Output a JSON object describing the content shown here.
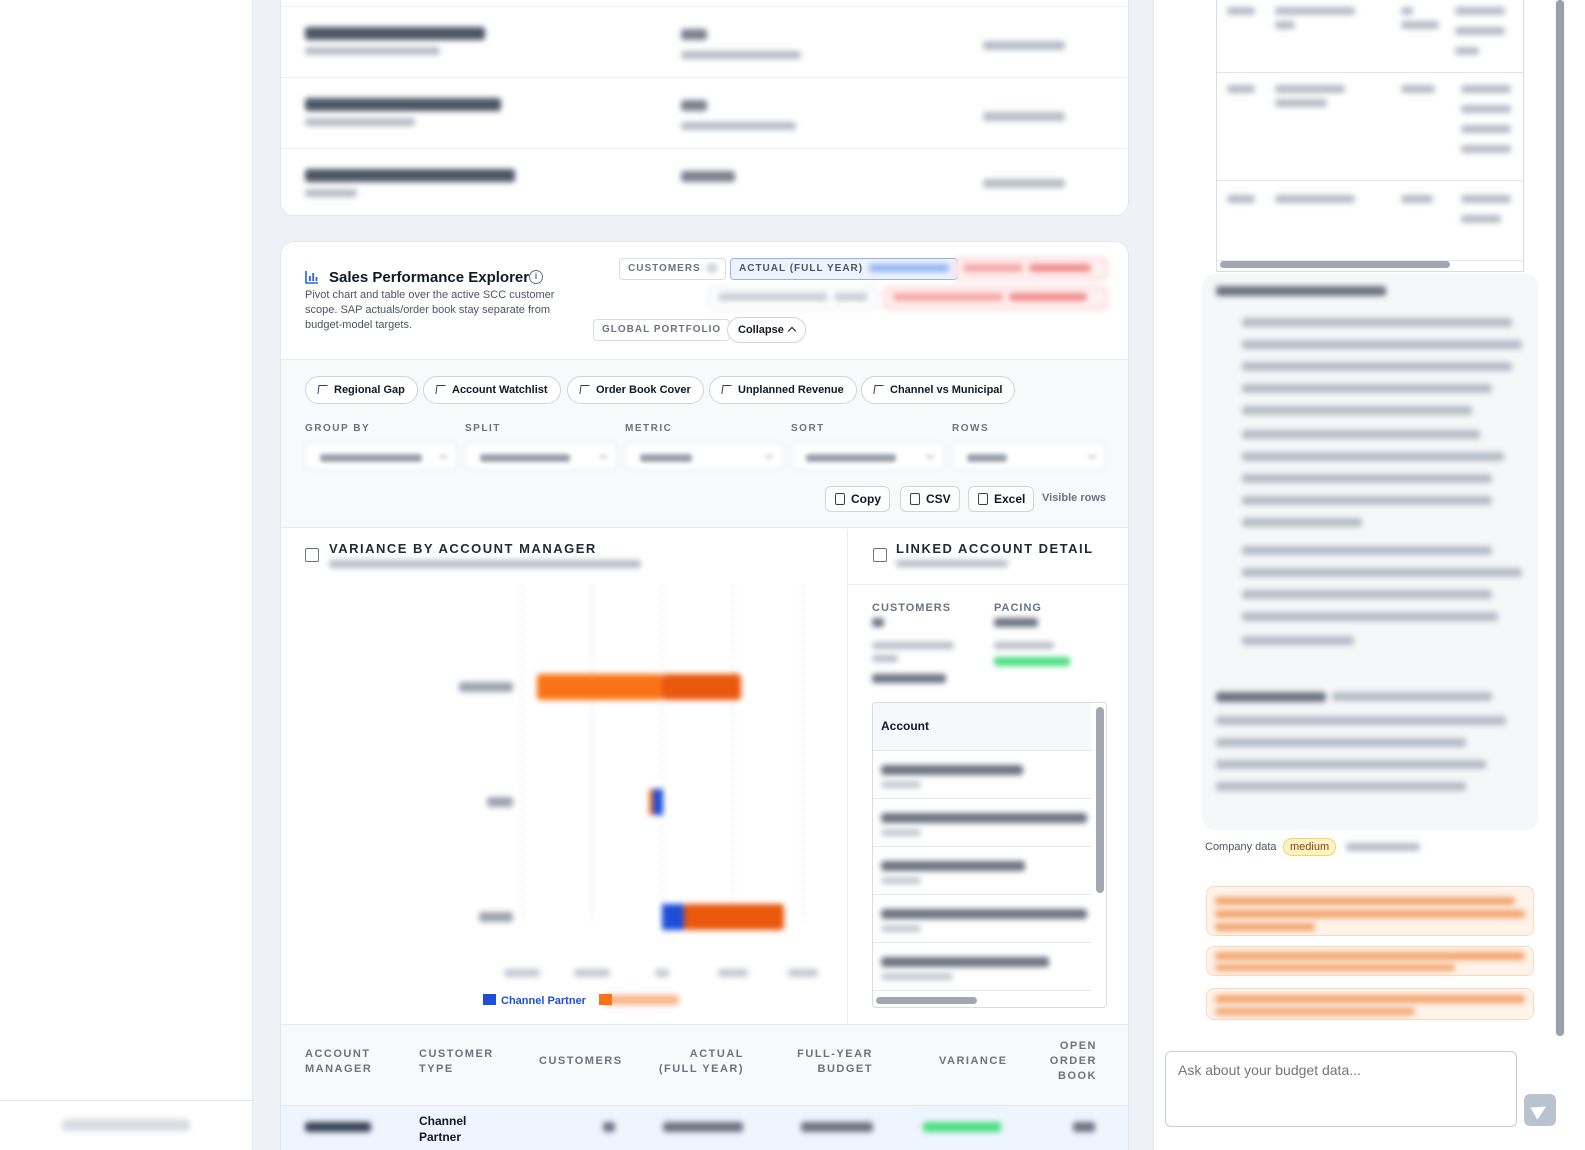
{
  "explorer": {
    "title": "Sales Performance Explorer",
    "subtitle": "Pivot chart and table over the active SCC customer scope. SAP actuals/order book stay separate from budget-model targets.",
    "chips": {
      "customers": "CUSTOMERS",
      "actual": "ACTUAL (FULL YEAR)",
      "global": "GLOBAL PORTFOLIO"
    },
    "collapse_label": "Collapse",
    "presets": [
      "Regional Gap",
      "Account Watchlist",
      "Order Book Cover",
      "Unplanned Revenue",
      "Channel vs Municipal"
    ],
    "filters": {
      "group_by": "GROUP BY",
      "split": "SPLIT",
      "metric": "METRIC",
      "sort": "SORT",
      "rows": "ROWS"
    },
    "export": {
      "copy": "Copy",
      "csv": "CSV",
      "excel": "Excel",
      "visible_rows": "Visible rows"
    }
  },
  "chart": {
    "title": "VARIANCE BY ACCOUNT MANAGER",
    "legend_channel": "Channel Partner"
  },
  "colors": {
    "channel_partner": "#1d4ed8",
    "other_type": "#f97316",
    "accent_blue": "#2563eb",
    "positive": "#16a34a"
  },
  "detail": {
    "title": "LINKED ACCOUNT DETAIL",
    "customers_label": "CUSTOMERS",
    "pacing_label": "PACING",
    "account_header": "Account"
  },
  "summary": {
    "headers": {
      "account_manager": "ACCOUNT MANAGER",
      "customer_type": "CUSTOMER TYPE",
      "customers": "CUSTOMERS",
      "actual": "ACTUAL (FULL YEAR)",
      "budget": "FULL-YEAR BUDGET",
      "variance": "VARIANCE",
      "open_order": "OPEN ORDER BOOK"
    },
    "row_customer_type": "Channel Partner"
  },
  "chat": {
    "company_data": "Company data",
    "confidence": "medium",
    "input_placeholder": "Ask about your budget data..."
  }
}
